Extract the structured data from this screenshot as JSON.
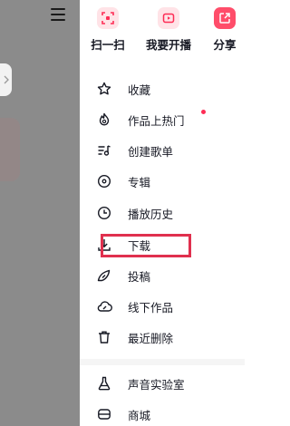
{
  "quick_actions": [
    {
      "label": "扫一扫",
      "icon": "scan-icon"
    },
    {
      "label": "我要开播",
      "icon": "live-icon"
    },
    {
      "label": "分享",
      "icon": "share-icon"
    }
  ],
  "menu_items": [
    {
      "label": "收藏",
      "icon": "star-icon"
    },
    {
      "label": "作品上热门",
      "icon": "fire-icon",
      "badge": true
    },
    {
      "label": "创建歌单",
      "icon": "playlist-icon"
    },
    {
      "label": "专辑",
      "icon": "album-icon"
    },
    {
      "label": "播放历史",
      "icon": "clock-icon"
    },
    {
      "label": "下载",
      "icon": "download-icon",
      "highlighted": true
    },
    {
      "label": "投稿",
      "icon": "submit-icon"
    },
    {
      "label": "线下作品",
      "icon": "cloud-offline-icon"
    },
    {
      "label": "最近删除",
      "icon": "trash-icon"
    }
  ],
  "secondary_items": [
    {
      "label": "声音实验室",
      "icon": "flask-icon"
    },
    {
      "label": "商城",
      "icon": "store-icon"
    }
  ],
  "colors": {
    "accent": "#fe2c55",
    "highlight_border": "#e0304e",
    "backdrop": "#8b8b8b"
  }
}
